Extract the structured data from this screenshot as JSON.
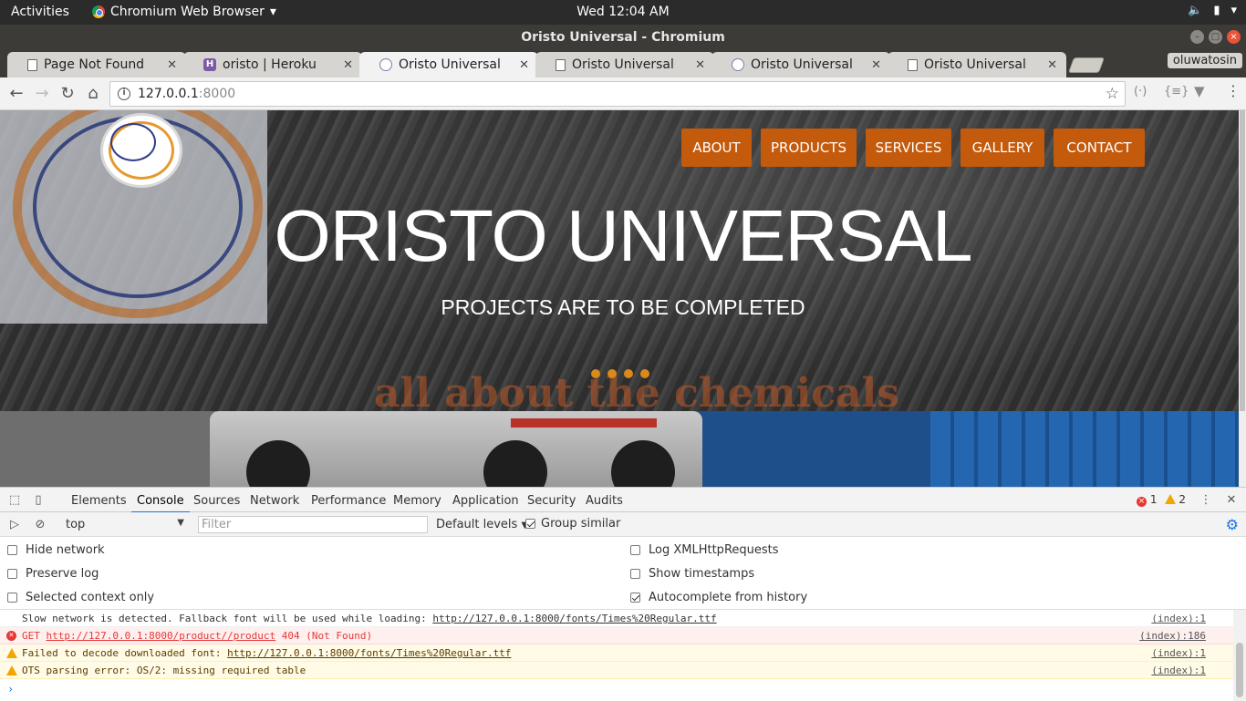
{
  "os": {
    "activities": "Activities",
    "app_menu": "Chromium Web Browser",
    "clock": "Wed 12:04 AM"
  },
  "window": {
    "title": "Oristo Universal - Chromium"
  },
  "tabs": [
    {
      "label": "Page Not Found",
      "icon": "document-icon"
    },
    {
      "label": "oristo | Heroku",
      "icon": "heroku-icon"
    },
    {
      "label": "Oristo Universal",
      "icon": "oristo-favicon",
      "active": true
    },
    {
      "label": "Oristo Universal",
      "icon": "document-icon"
    },
    {
      "label": "Oristo Universal",
      "icon": "oristo-favicon"
    },
    {
      "label": "Oristo Universal",
      "icon": "document-icon"
    }
  ],
  "profile": "oluwatosin",
  "address": {
    "host": "127.0.0.1",
    "port": ":8000"
  },
  "site": {
    "nav": [
      "ABOUT",
      "PRODUCTS",
      "SERVICES",
      "GALLERY",
      "CONTACT"
    ],
    "title": "ORISTO UNIVERSAL",
    "subtitle": "PROJECTS ARE TO BE COMPLETED",
    "background_text": "all about the chemicals",
    "accent_color": "#c45a0c"
  },
  "devtools": {
    "tabs": [
      "Elements",
      "Console",
      "Sources",
      "Network",
      "Performance",
      "Memory",
      "Application",
      "Security",
      "Audits"
    ],
    "active_tab": "Console",
    "error_count": "1",
    "warning_count": "2",
    "context": "top",
    "filter_placeholder": "Filter",
    "levels": "Default levels",
    "group_similar": "Group similar",
    "settings_left": [
      {
        "label": "Hide network",
        "checked": false
      },
      {
        "label": "Preserve log",
        "checked": false
      },
      {
        "label": "Selected context only",
        "checked": false
      }
    ],
    "settings_right": [
      {
        "label": "Log XMLHttpRequests",
        "checked": false
      },
      {
        "label": "Show timestamps",
        "checked": false
      },
      {
        "label": "Autocomplete from history",
        "checked": true
      }
    ],
    "messages": [
      {
        "level": "info",
        "text": "Slow network is detected. Fallback font will be used while loading: ",
        "link": "http://127.0.0.1:8000/fonts/Times%20Regular.ttf",
        "source": "(index):1"
      },
      {
        "level": "error",
        "text": "GET ",
        "link": "http://127.0.0.1:8000/product//product",
        "suffix": " 404 (Not Found)",
        "source": "(index):186"
      },
      {
        "level": "warn",
        "text": "Failed to decode downloaded font: ",
        "link": "http://127.0.0.1:8000/fonts/Times%20Regular.ttf",
        "source": "(index):1"
      },
      {
        "level": "warn",
        "text": "OTS parsing error: OS/2: missing required table",
        "source": "(index):1"
      }
    ]
  }
}
